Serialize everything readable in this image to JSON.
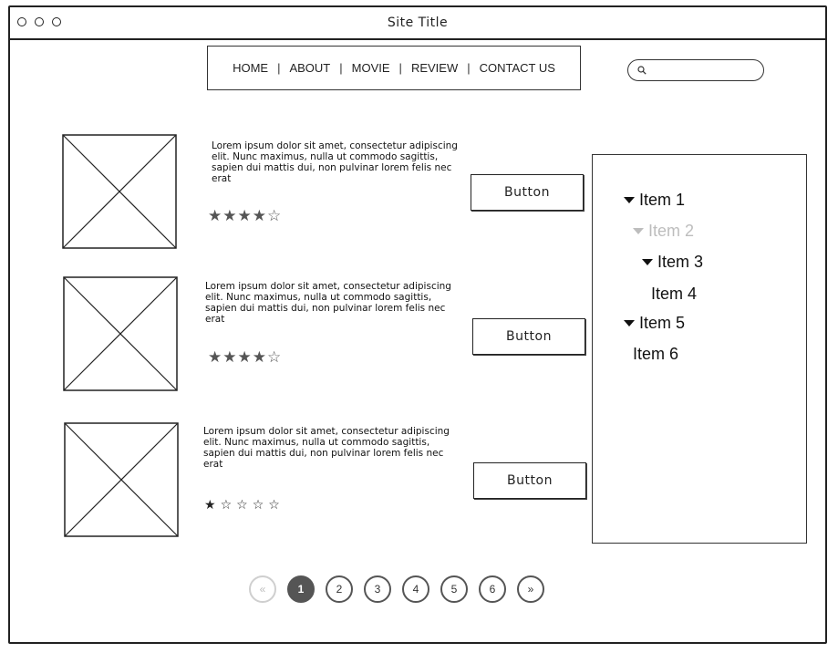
{
  "window": {
    "title": "Site Title"
  },
  "nav": {
    "links": [
      "HOME",
      "ABOUT",
      "MOVIE",
      "REVIEW",
      "CONTACT US"
    ],
    "separator": "|"
  },
  "search": {
    "placeholder": "",
    "value": "",
    "icon": "search-icon"
  },
  "products": [
    {
      "description": "Lorem ipsum dolor sit amet, consectetur adipiscing elit. Nunc maximus, nulla ut commodo sagittis, sapien dui mattis dui, non pulvinar lorem felis nec erat",
      "rating": 4,
      "max_rating": 5,
      "button_label": "Button"
    },
    {
      "description": "Lorem ipsum dolor sit amet, consectetur adipiscing elit. Nunc maximus, nulla ut commodo sagittis, sapien dui mattis dui, non pulvinar lorem felis nec erat",
      "rating": 4,
      "max_rating": 5,
      "button_label": "Button"
    },
    {
      "description": "Lorem ipsum dolor sit amet, consectetur adipiscing elit. Nunc maximus, nulla ut commodo sagittis, sapien dui mattis dui, non pulvinar lorem felis nec erat",
      "rating": 1,
      "max_rating": 5,
      "button_label": "Button"
    }
  ],
  "tree": {
    "items": [
      {
        "label": "Item 1",
        "expanded": true,
        "disabled": false
      },
      {
        "label": "Item 2",
        "expanded": true,
        "disabled": true
      },
      {
        "label": "Item 3",
        "expanded": true,
        "disabled": false
      },
      {
        "label": "Item 4",
        "expanded": false,
        "disabled": false
      },
      {
        "label": "Item 5",
        "expanded": true,
        "disabled": false
      },
      {
        "label": "Item 6",
        "expanded": false,
        "disabled": false
      }
    ]
  },
  "pagination": {
    "prev_label": "«",
    "next_label": "»",
    "pages": [
      "1",
      "2",
      "3",
      "4",
      "5",
      "6"
    ],
    "current_page": "1",
    "prev_disabled": true
  },
  "colors": {
    "ink": "#222222",
    "active_page": "#555555",
    "disabled": "#bdbdbd",
    "star": "#555555"
  }
}
